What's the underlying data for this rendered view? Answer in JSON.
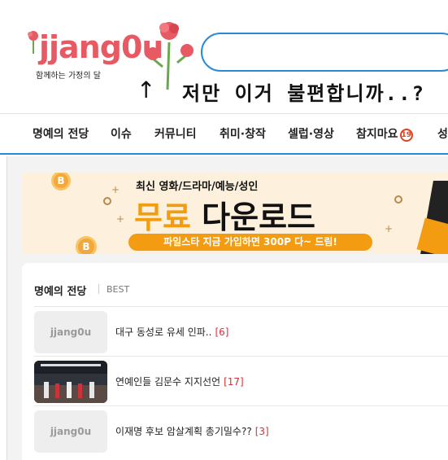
{
  "header": {
    "logo_text": "jjang0u",
    "logo_tagline": "함께하는 가정의 달",
    "search_placeholder": "",
    "arrow": "↑",
    "overlay_text": "저만 이거 불편합니까..?"
  },
  "nav": {
    "items": [
      {
        "label": "명예의 전당"
      },
      {
        "label": "이슈"
      },
      {
        "label": "커뮤니티"
      },
      {
        "label": "취미·창작"
      },
      {
        "label": "셀럽·영상"
      },
      {
        "label": "참지마요",
        "badge": "19"
      },
      {
        "label": "성"
      }
    ]
  },
  "banner": {
    "top_line": "최신 영화/드라마/예능/성인",
    "main_accent": "무료",
    "main_rest": " 다운로드",
    "pill": "파일스타 지금 가입하면 300P 다~ 드림!",
    "coin_symbol": "B"
  },
  "hall_of_fame": {
    "title": "명예의 전당",
    "subtitle": "BEST",
    "posts": [
      {
        "thumb": "jjang0u",
        "title": "대구 동성로 유세 인파..",
        "count": "[6]"
      },
      {
        "thumb": "",
        "title": "연예인들 김문수 지지선언",
        "count": "[17]"
      },
      {
        "thumb": "jjang0u",
        "title": "이재명 후보 암살계획 총기밀수??",
        "count": "[3]"
      }
    ]
  },
  "colors": {
    "brand_blue": "#2b8ad6",
    "logo_pink": "#e85a63",
    "banner_orange": "#f39c11",
    "count_red": "#d2333a"
  }
}
